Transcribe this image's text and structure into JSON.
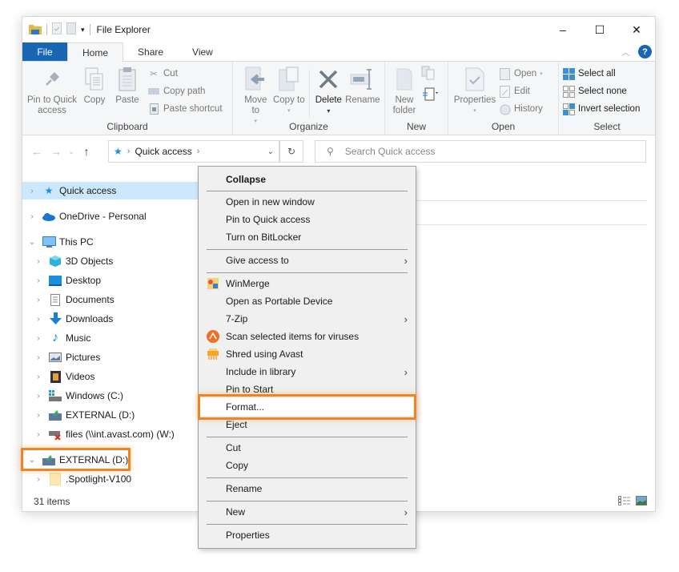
{
  "window": {
    "title": "File Explorer",
    "controls": {
      "minimize": "–",
      "maximize": "☐",
      "close": "✕"
    }
  },
  "tabs": [
    {
      "label": "File",
      "active": false
    },
    {
      "label": "Home",
      "active": true
    },
    {
      "label": "Share",
      "active": false
    },
    {
      "label": "View",
      "active": false
    }
  ],
  "help_label": "?",
  "ribbon": {
    "clipboard": {
      "label": "Clipboard",
      "pin": "Pin to Quick access",
      "copy": "Copy",
      "paste": "Paste",
      "cut": "Cut",
      "copy_path": "Copy path",
      "paste_shortcut": "Paste shortcut"
    },
    "organize": {
      "label": "Organize",
      "move_to": "Move to",
      "copy_to": "Copy to",
      "delete": "Delete",
      "rename": "Rename"
    },
    "new": {
      "label": "New",
      "new_folder": "New folder"
    },
    "open": {
      "label": "Open",
      "properties": "Properties",
      "open": "Open",
      "edit": "Edit",
      "history": "History"
    },
    "select": {
      "label": "Select",
      "select_all": "Select all",
      "select_none": "Select none",
      "invert_selection": "Invert selection"
    }
  },
  "address": {
    "crumb": "Quick access",
    "search_placeholder": "Search Quick access"
  },
  "tree": [
    {
      "label": "Quick access",
      "icon": "star-icon",
      "level": 0,
      "expanded": false,
      "selected": true
    },
    {
      "label": "OneDrive - Personal",
      "icon": "cloud-icon",
      "level": 0,
      "expanded": false
    },
    {
      "label": "This PC",
      "icon": "computer-icon",
      "level": 0,
      "expanded": true
    },
    {
      "label": "3D Objects",
      "icon": "cube-icon",
      "level": 1
    },
    {
      "label": "Desktop",
      "icon": "desktop-icon",
      "level": 1
    },
    {
      "label": "Documents",
      "icon": "document-icon",
      "level": 1
    },
    {
      "label": "Downloads",
      "icon": "download-icon",
      "level": 1
    },
    {
      "label": "Music",
      "icon": "music-icon",
      "level": 1
    },
    {
      "label": "Pictures",
      "icon": "picture-icon",
      "level": 1
    },
    {
      "label": "Videos",
      "icon": "video-icon",
      "level": 1
    },
    {
      "label": "Windows (C:)",
      "icon": "windows-drive-icon",
      "level": 1
    },
    {
      "label": "EXTERNAL (D:)",
      "icon": "usb-drive-icon",
      "level": 1
    },
    {
      "label": "files (\\\\int.avast.com) (W:)",
      "icon": "network-drive-icon",
      "level": 1
    },
    {
      "label": "EXTERNAL (D:)",
      "icon": "usb-drive-icon",
      "level": 0,
      "expanded": true,
      "highlighted": true
    },
    {
      "label": ".Spotlight-V100",
      "icon": "folder-icon",
      "level": 1
    }
  ],
  "status": {
    "items_count": "31 items"
  },
  "context_menu": {
    "items": [
      {
        "label": "Collapse",
        "bold": true
      },
      {
        "separator": true
      },
      {
        "label": "Open in new window"
      },
      {
        "label": "Pin to Quick access"
      },
      {
        "label": "Turn on BitLocker"
      },
      {
        "separator": true
      },
      {
        "label": "Give access to",
        "submenu": true
      },
      {
        "separator": true
      },
      {
        "label": "WinMerge",
        "icon": "winmerge-icon"
      },
      {
        "label": "Open as Portable Device"
      },
      {
        "label": "7-Zip",
        "submenu": true
      },
      {
        "label": "Scan selected items for viruses",
        "icon": "avast-icon"
      },
      {
        "label": "Shred using Avast",
        "icon": "shredder-icon"
      },
      {
        "label": "Include in library",
        "submenu": true
      },
      {
        "label": "Pin to Start"
      },
      {
        "label": "Format...",
        "highlighted": true
      },
      {
        "label": "Eject"
      },
      {
        "separator": true
      },
      {
        "label": "Cut"
      },
      {
        "label": "Copy"
      },
      {
        "separator": true
      },
      {
        "label": "Rename"
      },
      {
        "separator": true
      },
      {
        "label": "New",
        "submenu": true
      },
      {
        "separator": true
      },
      {
        "label": "Properties"
      }
    ]
  },
  "colors": {
    "accent": "#1966b3",
    "highlight": "#f58220",
    "selection": "#cce8ff"
  }
}
